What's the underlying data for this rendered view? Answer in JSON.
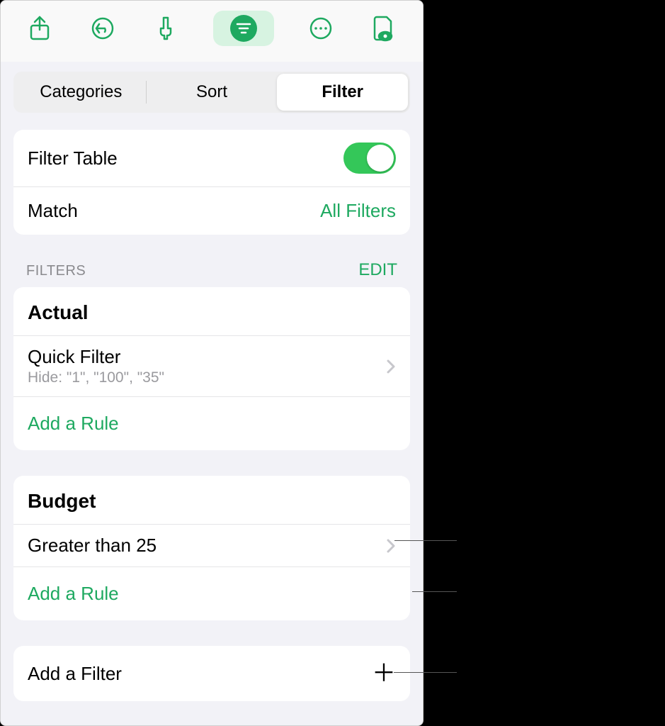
{
  "toolbar": {
    "icons": [
      "share-icon",
      "undo-icon",
      "brush-icon",
      "filter-icon",
      "more-icon",
      "document-view-icon"
    ]
  },
  "segmented": {
    "items": [
      "Categories",
      "Sort",
      "Filter"
    ],
    "active": 2
  },
  "settings": {
    "filter_table_label": "Filter Table",
    "filter_table_on": true,
    "match_label": "Match",
    "match_value": "All Filters"
  },
  "filters_section": {
    "label": "FILTERS",
    "edit_label": "EDIT"
  },
  "groups": [
    {
      "title": "Actual",
      "rules": [
        {
          "primary": "Quick Filter",
          "secondary": "Hide: \"1\", \"100\", \"35\""
        }
      ],
      "add_rule_label": "Add a Rule"
    },
    {
      "title": "Budget",
      "rules": [
        {
          "primary": "Greater than 25",
          "secondary": ""
        }
      ],
      "add_rule_label": "Add a Rule"
    }
  ],
  "add_filter": {
    "label": "Add a Filter"
  }
}
